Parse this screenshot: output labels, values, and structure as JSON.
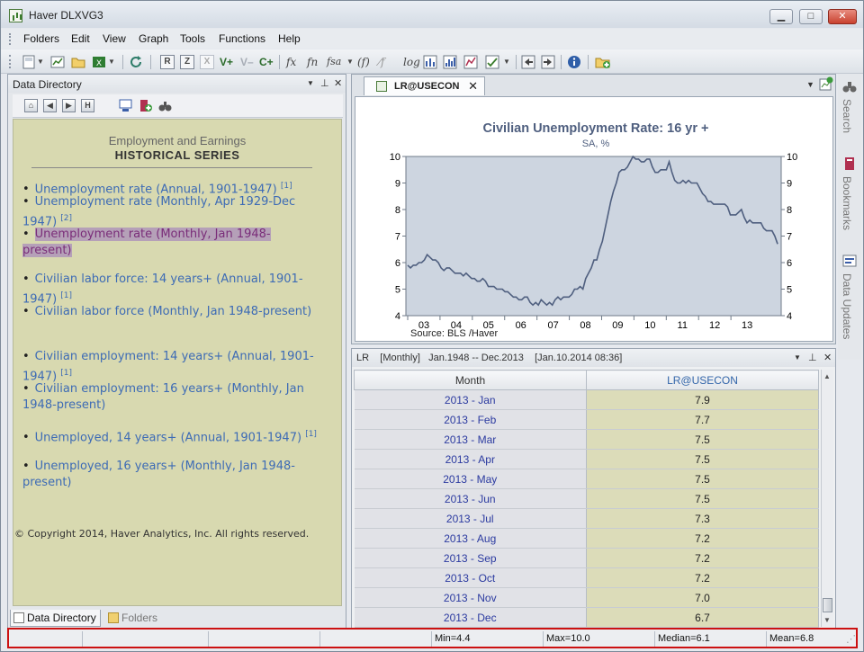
{
  "window": {
    "title": "Haver DLXVG3",
    "minimize": "▁",
    "maximize": "□",
    "close": "✕"
  },
  "menu": [
    "Folders",
    "Edit",
    "View",
    "Graph",
    "Tools",
    "Functions",
    "Help"
  ],
  "toolbar": {
    "box_r": "R",
    "box_z": "Z",
    "box_x": "X",
    "v_plus": "V+",
    "v_minus": "V–",
    "c_plus": "C+",
    "fx": "fx",
    "fn": "fn",
    "fsa": "fsa",
    "fcirc": "(f)",
    "fslash": "⁄f",
    "log": "log"
  },
  "directory": {
    "header": "Data Directory",
    "nav_h": "H",
    "heading1": "Employment and Earnings",
    "heading2": "HISTORICAL SERIES",
    "links": [
      {
        "text": "Unemployment rate (Annual, 1901-1947)",
        "note": "[1]"
      },
      {
        "text": "Unemployment rate (Monthly, Apr 1929-Dec 1947)",
        "note": "[2]"
      },
      {
        "text": "Unemployment rate (Monthly, Jan 1948-present)",
        "note": ""
      },
      {
        "text": "Civilian labor force: 14 years+ (Annual, 1901-1947)",
        "note": "[1]"
      },
      {
        "text": "Civilian labor force (Monthly, Jan 1948-present)",
        "note": ""
      },
      {
        "text": "Civilian employment: 14 years+ (Annual, 1901-1947)",
        "note": "[1]"
      },
      {
        "text": "Civilian employment: 16 years+ (Monthly, Jan 1948-present)",
        "note": ""
      },
      {
        "text": "Unemployed, 14 years+ (Annual, 1901-1947)",
        "note": "[1]"
      },
      {
        "text": "Unemployed, 16 years+ (Monthly, Jan 1948-present)",
        "note": ""
      }
    ],
    "copyright": "© Copyright 2014, Haver Analytics, Inc. All rights reserved.",
    "tabs": [
      "Data Directory",
      "Folders"
    ]
  },
  "chart_tab": {
    "label": "LR@USECON",
    "close": "✕"
  },
  "chart_data": {
    "type": "line",
    "title": "Civilian Unemployment Rate: 16 yr +",
    "subtitle": "SA, %",
    "source": "Source:  BLS /Haver",
    "x_ticks": [
      "03",
      "04",
      "05",
      "06",
      "07",
      "08",
      "09",
      "10",
      "11",
      "12",
      "13"
    ],
    "ylim": [
      4,
      10
    ],
    "y_ticks": [
      4,
      5,
      6,
      7,
      8,
      9,
      10
    ],
    "series": [
      {
        "values": [
          5.9,
          5.8,
          5.9,
          5.9,
          6.0,
          6.0,
          6.1,
          6.3,
          6.2,
          6.1,
          6.1,
          6.0,
          5.8,
          5.7,
          5.8,
          5.8,
          5.7,
          5.6,
          5.6,
          5.6,
          5.5,
          5.6,
          5.5,
          5.4,
          5.4,
          5.3,
          5.3,
          5.4,
          5.3,
          5.1,
          5.1,
          5.1,
          5.0,
          5.0,
          5.0,
          4.9,
          4.9,
          4.8,
          4.7,
          4.7,
          4.6,
          4.6,
          4.7,
          4.7,
          4.5,
          4.4,
          4.5,
          4.4,
          4.6,
          4.5,
          4.4,
          4.5,
          4.4,
          4.6,
          4.7,
          4.6,
          4.7,
          4.7,
          4.7,
          4.8,
          5.0,
          5.0,
          5.1,
          5.0,
          5.4,
          5.6,
          5.8,
          6.1,
          6.1,
          6.5,
          6.8,
          7.3,
          7.8,
          8.3,
          8.7,
          9.0,
          9.4,
          9.5,
          9.5,
          9.6,
          9.8,
          10.0,
          9.9,
          9.9,
          9.8,
          9.8,
          9.9,
          9.9,
          9.6,
          9.4,
          9.4,
          9.5,
          9.5,
          9.5,
          9.8,
          9.4,
          9.1,
          9.0,
          9.0,
          9.1,
          9.0,
          9.1,
          9.0,
          9.0,
          9.0,
          8.8,
          8.6,
          8.5,
          8.3,
          8.3,
          8.2,
          8.2,
          8.2,
          8.2,
          8.2,
          8.1,
          7.8,
          7.8,
          7.8,
          7.9,
          8.0,
          7.7,
          7.5,
          7.6,
          7.5,
          7.5,
          7.5,
          7.5,
          7.3,
          7.2,
          7.2,
          7.2,
          7.0,
          6.7
        ]
      }
    ]
  },
  "table": {
    "header_info": "LR    [Monthly]   Jan.1948 -- Dec.2013    [Jan.10.2014 08:36]",
    "columns": [
      "Month",
      "LR@USECON"
    ],
    "rows": [
      [
        "2013 - Jan",
        "7.9"
      ],
      [
        "2013 - Feb",
        "7.7"
      ],
      [
        "2013 - Mar",
        "7.5"
      ],
      [
        "2013 - Apr",
        "7.5"
      ],
      [
        "2013 - May",
        "7.5"
      ],
      [
        "2013 - Jun",
        "7.5"
      ],
      [
        "2013 - Jul",
        "7.3"
      ],
      [
        "2013 - Aug",
        "7.2"
      ],
      [
        "2013 - Sep",
        "7.2"
      ],
      [
        "2013 - Oct",
        "7.2"
      ],
      [
        "2013 - Nov",
        "7.0"
      ],
      [
        "2013 - Dec",
        "6.7"
      ]
    ]
  },
  "side": {
    "search": "Search",
    "bookmarks": "Bookmarks",
    "updates": "Data Updates"
  },
  "status": {
    "min": "Min=4.4",
    "max": "Max=10.0",
    "median": "Median=6.1",
    "mean": "Mean=6.8"
  },
  "colors": {
    "line": "#4f5f7f",
    "plot_bg": "#cdd5e0",
    "directory_bg": "#d8d9b0",
    "status_border": "#cc1111"
  }
}
